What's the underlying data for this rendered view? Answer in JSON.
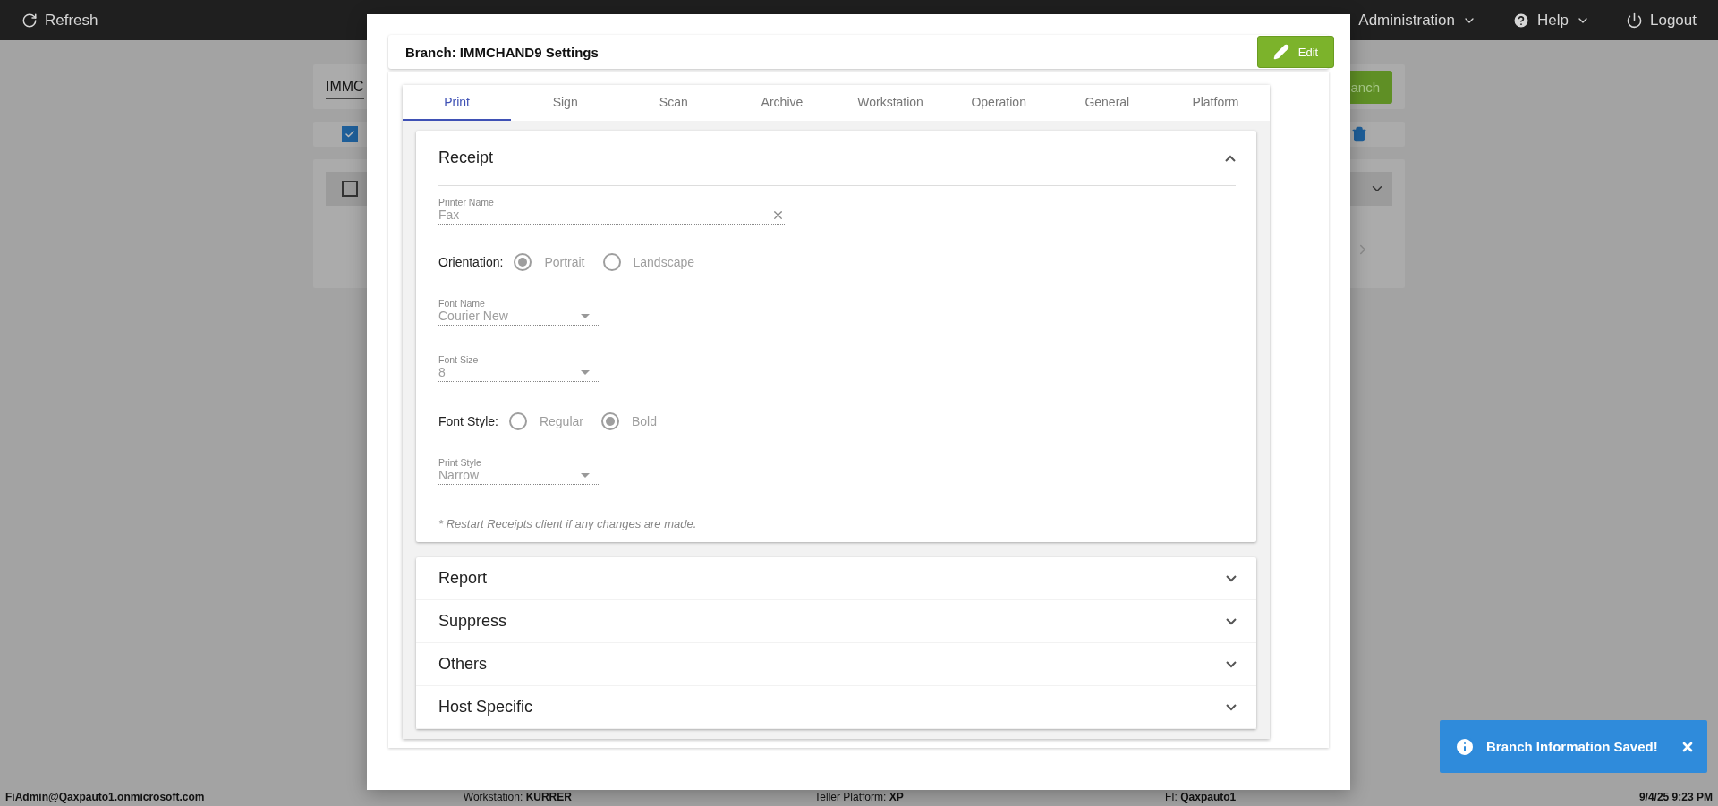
{
  "top_bar": {
    "refresh": "Refresh",
    "menus": [
      {
        "kind": "dropdown",
        "label": "Administration"
      },
      {
        "kind": "help",
        "label": "Help"
      },
      {
        "kind": "logout",
        "label": "Logout"
      }
    ]
  },
  "background": {
    "search_value": "IMMC",
    "search_button": "anch",
    "select_all_checked": true,
    "row_checked": false
  },
  "dialog": {
    "title": "Branch: IMMCHAND9 Settings",
    "edit_button": "Edit",
    "tabs": [
      {
        "label": "Print",
        "selected": true
      },
      {
        "label": "Sign",
        "selected": false
      },
      {
        "label": "Scan",
        "selected": false
      },
      {
        "label": "Archive",
        "selected": false
      },
      {
        "label": "Workstation",
        "selected": false
      },
      {
        "label": "Operation",
        "selected": false
      },
      {
        "label": "General",
        "selected": false
      },
      {
        "label": "Platform",
        "selected": false
      }
    ],
    "sections": [
      {
        "title": "Receipt",
        "expanded": true,
        "fields": [
          {
            "kind": "text",
            "label": "Printer Name",
            "value": "Fax"
          },
          {
            "kind": "radio",
            "label": "Orientation:",
            "options": [
              {
                "label": "Portrait",
                "selected": true
              },
              {
                "label": "Landscape",
                "selected": false
              }
            ]
          },
          {
            "kind": "select",
            "label": "Font Name",
            "value": "Courier New"
          },
          {
            "kind": "select",
            "label": "Font Size",
            "value": "8"
          },
          {
            "kind": "radio",
            "label": "Font Style:",
            "options": [
              {
                "label": "Regular",
                "selected": false
              },
              {
                "label": "Bold",
                "selected": true
              }
            ]
          },
          {
            "kind": "select",
            "label": "Print Style",
            "value": "Narrow"
          }
        ],
        "note": "* Restart Receipts client if any changes are made."
      },
      {
        "title": "Report",
        "expanded": false
      },
      {
        "title": "Suppress",
        "expanded": false
      },
      {
        "title": "Others",
        "expanded": false
      },
      {
        "title": "Host Specific",
        "expanded": false
      }
    ]
  },
  "toast": {
    "message": "Branch Information Saved!"
  },
  "status_bar": {
    "user": "FiAdmin@Qaxpauto1.onmicrosoft.com",
    "items": [
      "Workstation: **KURRER**",
      "Teller Platform: **XP**",
      "FI: **Qaxpauto1**"
    ],
    "time": "9/4/25 9:23 PM"
  }
}
